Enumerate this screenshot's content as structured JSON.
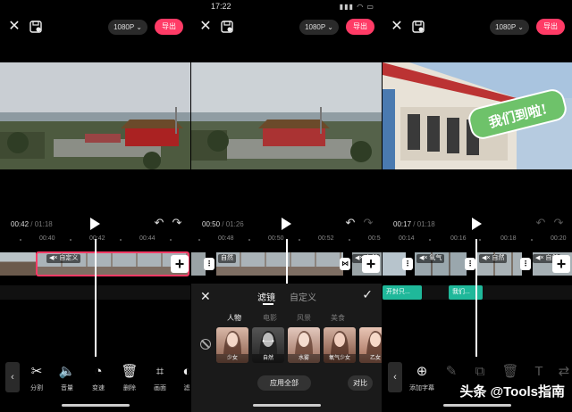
{
  "status_time": "17:22",
  "resolution": "1080P",
  "export_label": "导出",
  "colors": {
    "accent": "#ff3b66",
    "subtitle": "#1fb89a"
  },
  "icons": {
    "close": "close-icon",
    "save": "save-draft-icon",
    "play": "play-icon",
    "undo": "undo-icon",
    "redo": "redo-icon",
    "add": "add-clip-icon",
    "split": "scissors-icon",
    "volume": "speaker-icon",
    "speed": "speedometer-icon",
    "delete": "trash-icon",
    "crop": "crop-icon"
  },
  "panel1": {
    "time_current": "00:42",
    "time_total": " / 01:18",
    "ticks": [
      "00:40",
      "00:42",
      "00:44"
    ],
    "clip_chip": "◀× 自定义",
    "tools": [
      {
        "label": "分割",
        "icon": "✂"
      },
      {
        "label": "音量",
        "icon": "🔈"
      },
      {
        "label": "变速",
        "icon": "◔"
      },
      {
        "label": "删除",
        "icon": "🗑"
      },
      {
        "label": "画面",
        "icon": "⌗"
      },
      {
        "label": "滤",
        "icon": "◐"
      }
    ]
  },
  "panel2": {
    "time_current": "00:50",
    "time_total": " / 01:26",
    "ticks": [
      "00:48",
      "00:50",
      "00:52",
      "00:5"
    ],
    "clip_chip": "自然",
    "clip_chip2": "◀× 自然",
    "tabs": [
      "滤镜",
      "自定义"
    ],
    "categories": [
      "人物",
      "电影",
      "风景",
      "美食"
    ],
    "filters": [
      "少女",
      "自然",
      "水雾",
      "氧气少女",
      "乙女"
    ],
    "apply_all": "应用全部",
    "compare": "对比"
  },
  "panel3": {
    "time_current": "00:17",
    "time_total": " / 01:18",
    "ticks": [
      "00:14",
      "00:16",
      "00:18",
      "00:20"
    ],
    "clip_chips": [
      "◀× 氧气",
      "◀× 自然",
      "◀× 自然"
    ],
    "sticker_text": "我们到啦!",
    "subtitles": [
      "开封只...",
      "我们..."
    ],
    "tools": [
      {
        "label": "添加字幕",
        "icon": "⊕"
      },
      {
        "label": "",
        "icon": "✎"
      },
      {
        "label": "",
        "icon": "⧉"
      },
      {
        "label": "",
        "icon": "🗑"
      },
      {
        "label": "",
        "icon": "T"
      },
      {
        "label": "",
        "icon": "⇄"
      }
    ],
    "watermark": "头条 @Tools指南"
  }
}
